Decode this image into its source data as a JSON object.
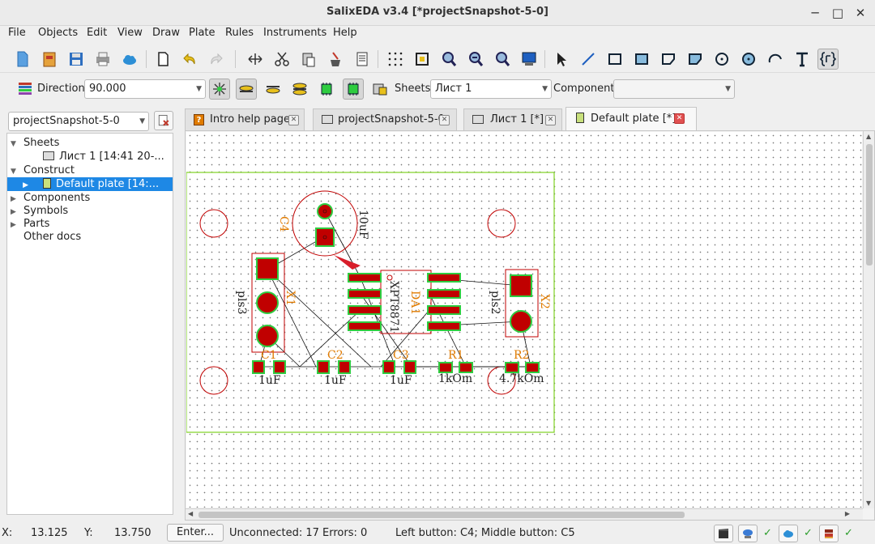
{
  "app": {
    "title": "SalixEDA v3.4 [*projectSnapshot-5-0]"
  },
  "window_controls": {
    "minimize": "─",
    "maximize": "□",
    "close": "✕"
  },
  "menu": [
    "File",
    "Objects",
    "Edit",
    "View",
    "Draw",
    "Plate",
    "Rules",
    "Instruments",
    "Help"
  ],
  "toolbar2": {
    "direction_label": "Direction:",
    "direction_value": "90.000",
    "sheets_label": "Sheets:",
    "sheets_value": "Лист 1",
    "component_label": "Component:",
    "component_value": ""
  },
  "project_select": "projectSnapshot-5-0",
  "tree": {
    "sheets": "Sheets",
    "sheet1": "Лист 1 [14:41 20-...",
    "construct": "Construct",
    "default_plate": "Default plate [14:...",
    "components": "Components",
    "symbols": "Symbols",
    "parts": "Parts",
    "other_docs": "Other docs"
  },
  "tabs": [
    "Intro help page",
    "projectSnapshot-5-0",
    "Лист 1 [*]",
    "Default plate [*]"
  ],
  "pcb": {
    "C4": "C4",
    "C4_val": "10uF",
    "X1": "X1",
    "X1_val": "pls3",
    "X2": "X2",
    "X2_val": "pls2",
    "DA1": "DA1",
    "DA1_val": "XPT8871",
    "C1": "C1",
    "C1_val": "1uF",
    "C2": "C2",
    "C2_val": "1uF",
    "C3": "C3",
    "C3_val": "1uF",
    "R1": "R1",
    "R1_val": "1kOm",
    "R2": "R2",
    "R2_val": "4.7kOm"
  },
  "status": {
    "x_label": "X:",
    "x_value": "13.125",
    "y_label": "Y:",
    "y_value": "13.750",
    "enter_button": "Enter...",
    "info": "Unconnected: 17  Errors: 0",
    "buttons": "Left button: C4;   Middle button: C5",
    "check": "✓"
  },
  "colors": {
    "pad": "#c00000",
    "pad_border": "#2ecc40",
    "silk": "#c00000",
    "label": "#e07b00",
    "board": "#7ed321",
    "selection": "#1e88e5"
  }
}
